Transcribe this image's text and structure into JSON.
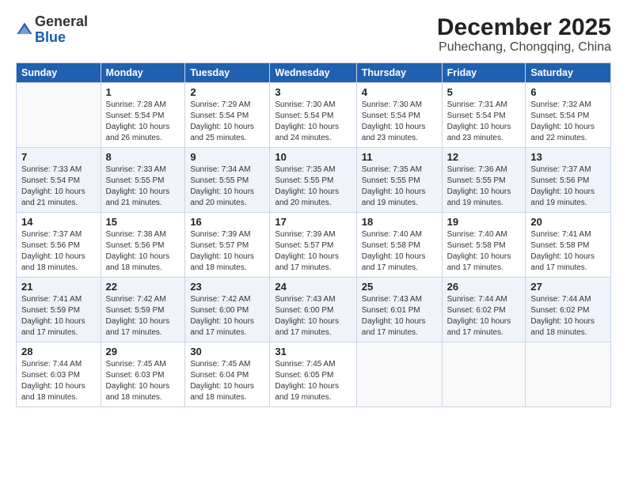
{
  "header": {
    "logo_general": "General",
    "logo_blue": "Blue",
    "month_title": "December 2025",
    "location": "Puhechang, Chongqing, China"
  },
  "weekdays": [
    "Sunday",
    "Monday",
    "Tuesday",
    "Wednesday",
    "Thursday",
    "Friday",
    "Saturday"
  ],
  "weeks": [
    [
      {
        "day": "",
        "info": ""
      },
      {
        "day": "1",
        "info": "Sunrise: 7:28 AM\nSunset: 5:54 PM\nDaylight: 10 hours\nand 26 minutes."
      },
      {
        "day": "2",
        "info": "Sunrise: 7:29 AM\nSunset: 5:54 PM\nDaylight: 10 hours\nand 25 minutes."
      },
      {
        "day": "3",
        "info": "Sunrise: 7:30 AM\nSunset: 5:54 PM\nDaylight: 10 hours\nand 24 minutes."
      },
      {
        "day": "4",
        "info": "Sunrise: 7:30 AM\nSunset: 5:54 PM\nDaylight: 10 hours\nand 23 minutes."
      },
      {
        "day": "5",
        "info": "Sunrise: 7:31 AM\nSunset: 5:54 PM\nDaylight: 10 hours\nand 23 minutes."
      },
      {
        "day": "6",
        "info": "Sunrise: 7:32 AM\nSunset: 5:54 PM\nDaylight: 10 hours\nand 22 minutes."
      }
    ],
    [
      {
        "day": "7",
        "info": "Sunrise: 7:33 AM\nSunset: 5:54 PM\nDaylight: 10 hours\nand 21 minutes."
      },
      {
        "day": "8",
        "info": "Sunrise: 7:33 AM\nSunset: 5:55 PM\nDaylight: 10 hours\nand 21 minutes."
      },
      {
        "day": "9",
        "info": "Sunrise: 7:34 AM\nSunset: 5:55 PM\nDaylight: 10 hours\nand 20 minutes."
      },
      {
        "day": "10",
        "info": "Sunrise: 7:35 AM\nSunset: 5:55 PM\nDaylight: 10 hours\nand 20 minutes."
      },
      {
        "day": "11",
        "info": "Sunrise: 7:35 AM\nSunset: 5:55 PM\nDaylight: 10 hours\nand 19 minutes."
      },
      {
        "day": "12",
        "info": "Sunrise: 7:36 AM\nSunset: 5:55 PM\nDaylight: 10 hours\nand 19 minutes."
      },
      {
        "day": "13",
        "info": "Sunrise: 7:37 AM\nSunset: 5:56 PM\nDaylight: 10 hours\nand 19 minutes."
      }
    ],
    [
      {
        "day": "14",
        "info": "Sunrise: 7:37 AM\nSunset: 5:56 PM\nDaylight: 10 hours\nand 18 minutes."
      },
      {
        "day": "15",
        "info": "Sunrise: 7:38 AM\nSunset: 5:56 PM\nDaylight: 10 hours\nand 18 minutes."
      },
      {
        "day": "16",
        "info": "Sunrise: 7:39 AM\nSunset: 5:57 PM\nDaylight: 10 hours\nand 18 minutes."
      },
      {
        "day": "17",
        "info": "Sunrise: 7:39 AM\nSunset: 5:57 PM\nDaylight: 10 hours\nand 17 minutes."
      },
      {
        "day": "18",
        "info": "Sunrise: 7:40 AM\nSunset: 5:58 PM\nDaylight: 10 hours\nand 17 minutes."
      },
      {
        "day": "19",
        "info": "Sunrise: 7:40 AM\nSunset: 5:58 PM\nDaylight: 10 hours\nand 17 minutes."
      },
      {
        "day": "20",
        "info": "Sunrise: 7:41 AM\nSunset: 5:58 PM\nDaylight: 10 hours\nand 17 minutes."
      }
    ],
    [
      {
        "day": "21",
        "info": "Sunrise: 7:41 AM\nSunset: 5:59 PM\nDaylight: 10 hours\nand 17 minutes."
      },
      {
        "day": "22",
        "info": "Sunrise: 7:42 AM\nSunset: 5:59 PM\nDaylight: 10 hours\nand 17 minutes."
      },
      {
        "day": "23",
        "info": "Sunrise: 7:42 AM\nSunset: 6:00 PM\nDaylight: 10 hours\nand 17 minutes."
      },
      {
        "day": "24",
        "info": "Sunrise: 7:43 AM\nSunset: 6:00 PM\nDaylight: 10 hours\nand 17 minutes."
      },
      {
        "day": "25",
        "info": "Sunrise: 7:43 AM\nSunset: 6:01 PM\nDaylight: 10 hours\nand 17 minutes."
      },
      {
        "day": "26",
        "info": "Sunrise: 7:44 AM\nSunset: 6:02 PM\nDaylight: 10 hours\nand 17 minutes."
      },
      {
        "day": "27",
        "info": "Sunrise: 7:44 AM\nSunset: 6:02 PM\nDaylight: 10 hours\nand 18 minutes."
      }
    ],
    [
      {
        "day": "28",
        "info": "Sunrise: 7:44 AM\nSunset: 6:03 PM\nDaylight: 10 hours\nand 18 minutes."
      },
      {
        "day": "29",
        "info": "Sunrise: 7:45 AM\nSunset: 6:03 PM\nDaylight: 10 hours\nand 18 minutes."
      },
      {
        "day": "30",
        "info": "Sunrise: 7:45 AM\nSunset: 6:04 PM\nDaylight: 10 hours\nand 18 minutes."
      },
      {
        "day": "31",
        "info": "Sunrise: 7:45 AM\nSunset: 6:05 PM\nDaylight: 10 hours\nand 19 minutes."
      },
      {
        "day": "",
        "info": ""
      },
      {
        "day": "",
        "info": ""
      },
      {
        "day": "",
        "info": ""
      }
    ]
  ]
}
